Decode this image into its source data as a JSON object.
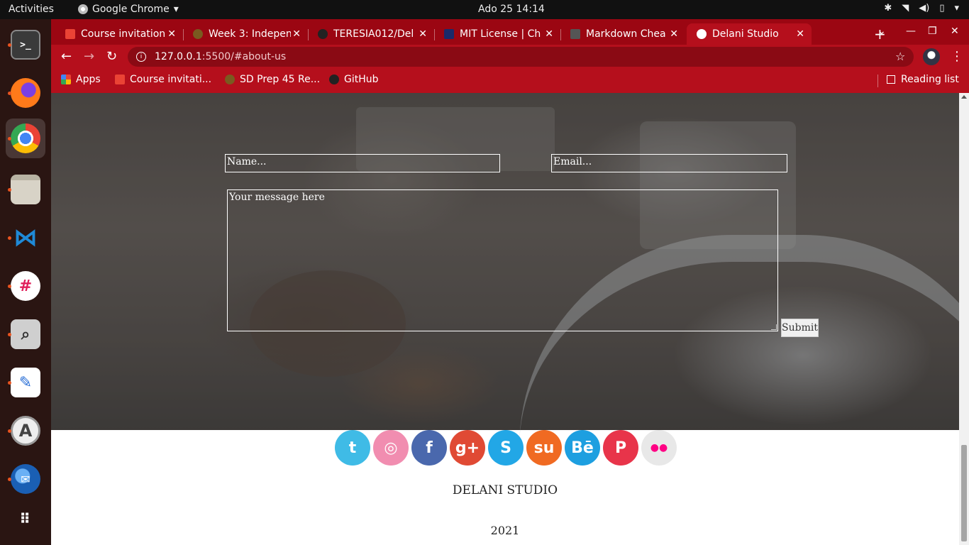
{
  "topbar": {
    "activities": "Activities",
    "app": "Google Chrome",
    "clock": "Ado 25  14:14"
  },
  "dock": {
    "items": [
      "terminal-icon",
      "firefox-icon",
      "chrome-icon",
      "files-icon",
      "vscode-icon",
      "slack-icon",
      "screenshot-icon",
      "text-editor-icon",
      "software-icon",
      "thunderbird-icon",
      "apps-grid-icon"
    ]
  },
  "tabs": [
    {
      "title": "Course invitation",
      "favicon_color": "#ea4335"
    },
    {
      "title": "Week 3: Indepen",
      "favicon_color": "#7a5a20"
    },
    {
      "title": "TERESIA012/Del",
      "favicon_color": "#222222"
    },
    {
      "title": "MIT License | Ch",
      "favicon_color": "#1a2a6a"
    },
    {
      "title": "Markdown Chea",
      "favicon_color": "#555555"
    },
    {
      "title": "Delani Studio",
      "favicon_color": "#ffffff"
    }
  ],
  "toolbar": {
    "url_host": "127.0.0.1",
    "url_path": ":5500/#about-us"
  },
  "bookmarks": {
    "items": [
      {
        "label": "Apps"
      },
      {
        "label": "Course invitati..."
      },
      {
        "label": "SD Prep 45 Re..."
      },
      {
        "label": "GitHub"
      }
    ],
    "reading_list": "Reading list"
  },
  "form": {
    "name_placeholder": "Name...",
    "email_placeholder": "Email...",
    "message_placeholder": "Your message here",
    "submit_label": "Submit"
  },
  "social": [
    {
      "name": "twitter-icon",
      "color": "#3fbbe6",
      "glyph": "t"
    },
    {
      "name": "dribbble-icon",
      "color": "#f18db0",
      "glyph": "◎"
    },
    {
      "name": "facebook-icon",
      "color": "#4a68ad",
      "glyph": "f"
    },
    {
      "name": "google-plus-icon",
      "color": "#e04a34",
      "glyph": "g+"
    },
    {
      "name": "skype-icon",
      "color": "#22a7e6",
      "glyph": "S"
    },
    {
      "name": "stumbleupon-icon",
      "color": "#f06a22",
      "glyph": "su"
    },
    {
      "name": "behance-icon",
      "color": "#1d9fe0",
      "glyph": "Bē"
    },
    {
      "name": "pinterest-icon",
      "color": "#e8344a",
      "glyph": "P"
    },
    {
      "name": "flickr-icon",
      "color": "#e8e8e8",
      "glyph": "●●"
    }
  ],
  "footer": {
    "studio": "DELANI STUDIO",
    "year": "2021"
  }
}
